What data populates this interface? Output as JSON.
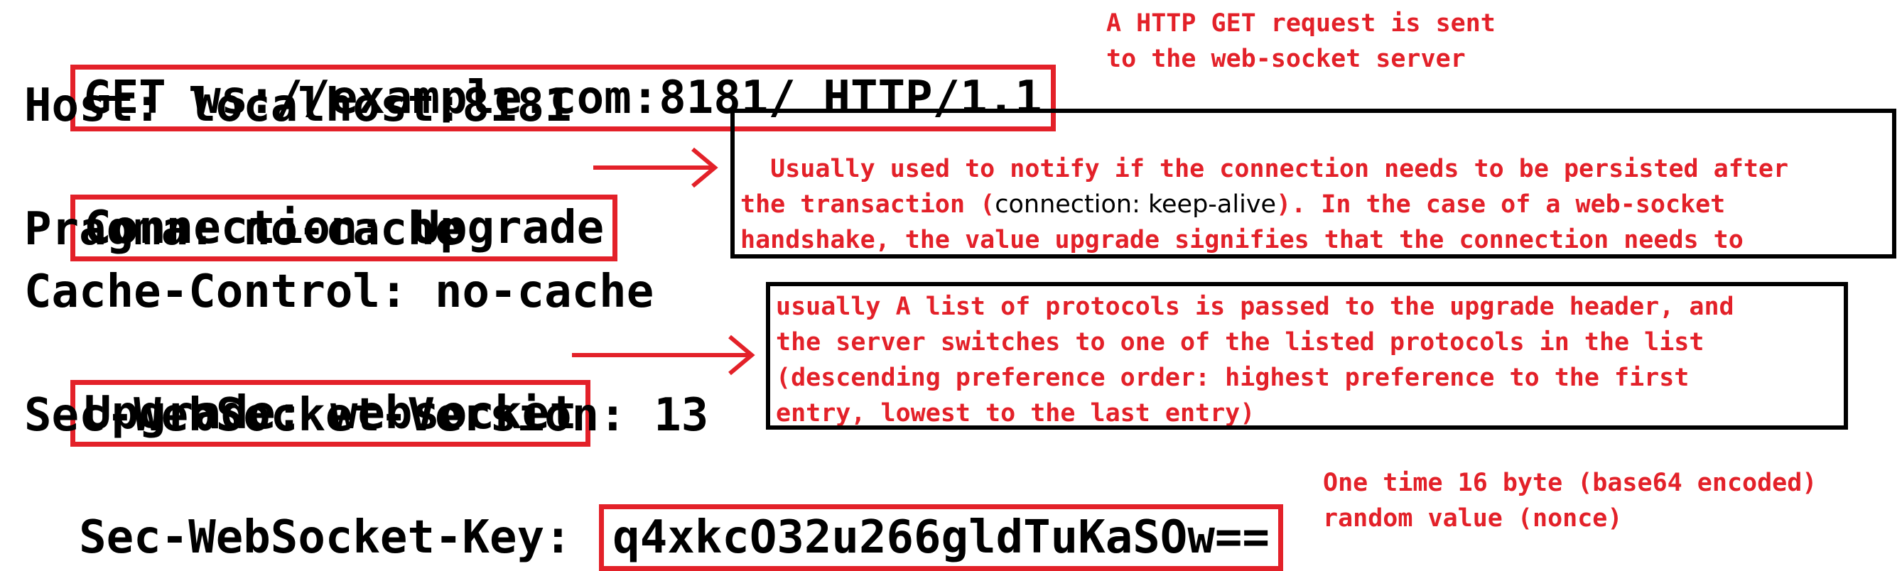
{
  "request_lines": {
    "get": "GET ws://example.com:8181/ HTTP/1.1",
    "host": "Host: localhost:8181",
    "connection": "Connection: Upgrade",
    "pragma": "Pragma: no-cache",
    "cache_control": "Cache-Control: no-cache",
    "upgrade": "Upgrade: websocket",
    "version": "Sec-WebSocket-Version: 13",
    "key_label": "Sec-WebSocket-Key: ",
    "key_value": "q4xkcO32u266gldTuKaSOw=="
  },
  "annotations": {
    "get_note": "A HTTP GET request is sent\nto the web-socket server",
    "connection_note": {
      "part1": "Usually used to notify if the connection needs to be persisted after\nthe transaction (",
      "code": "connection: keep-alive",
      "part2": "). In the case of a web-socket\nhandshake, the value upgrade signifies that the connection needs to\nbe persisted and will be used for non HTTP messages"
    },
    "upgrade_note": "usually A list of protocols is passed to the upgrade header, and\nthe server switches to one of the listed protocols in the list\n(descending preference order: highest preference to the first\nentry, lowest to the last entry)",
    "key_note": "One time 16 byte (base64 encoded)\nrandom value (nonce)"
  },
  "colors": {
    "highlight_red": "#e32129",
    "text_black": "#000000",
    "note_border": "#000000"
  }
}
